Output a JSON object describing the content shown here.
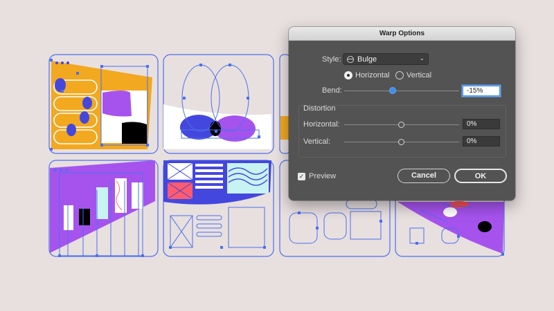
{
  "dialog": {
    "title": "Warp Options",
    "style_label": "Style:",
    "style_value": "Bulge",
    "style_icon": "bulge-icon",
    "orientation": {
      "horizontal_label": "Horizontal",
      "vertical_label": "Vertical",
      "selected": "Horizontal"
    },
    "bend_label": "Bend:",
    "bend_value": "-15%",
    "distortion": {
      "title": "Distortion",
      "horizontal_label": "Horizontal:",
      "horizontal_value": "0%",
      "vertical_label": "Vertical:",
      "vertical_value": "0%"
    },
    "preview_label": "Preview",
    "preview_checked": true,
    "cancel_label": "Cancel",
    "ok_label": "OK"
  },
  "colors": {
    "background": "#e8dfdf",
    "selection": "#4a70ee",
    "orange": "#f2a81f",
    "purple": "#a653ee",
    "indigo": "#4447de",
    "dialog": "#535353",
    "accent_blue": "#3d8eef"
  }
}
